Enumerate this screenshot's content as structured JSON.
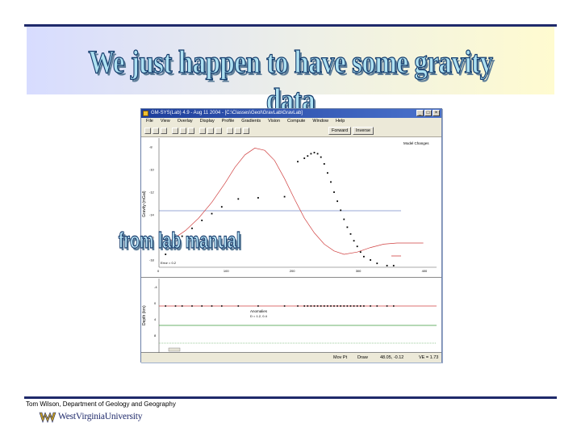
{
  "slide": {
    "title": "We just happen to have some gravity data",
    "callout": "from lab manual",
    "footer_credit": "Tom Wilson, Department of Geology and Geography",
    "institution": "WestVirginiaUniversity"
  },
  "colors": {
    "title_fill": "#aee1f1",
    "title_outline": "#123a6b",
    "rule": "#1f2a6b",
    "titlebar": "#1e3e9a",
    "model_curve": "#d04040",
    "observed_points": "#000000",
    "lower_line_red": "#d04040",
    "lower_line_green": "#3a9a3a"
  },
  "window": {
    "title": "GM-SYS(Lab) 4.9 - Aug 11 2004 - [C:\\Classes\\GeoI\\GravLab\\GravLab]",
    "controls": [
      "_",
      "□",
      "×"
    ],
    "menu": [
      "File",
      "View",
      "Overlay",
      "Display",
      "Profile",
      "Gradients",
      "Vision",
      "Compute",
      "Window",
      "Help"
    ],
    "toolbar_buttons": [
      "Forward",
      "Inverse"
    ],
    "upper_plot": {
      "y_label": "Gravity (mGal)",
      "legend_label": "Model Changes",
      "error_label": "Error = 0.2"
    },
    "lower_plot": {
      "y_label": "Depth (km)",
      "annotation_title": "Anomalies",
      "annotation_value": "D = 1.2, 0.4"
    },
    "status": {
      "mode": "Mov Pt",
      "action": "Draw",
      "coords": "48.05, -0.12",
      "ve": "VE = 1.73"
    }
  },
  "chart_data": {
    "type": "scatter",
    "x_ticks": [
      "0",
      "100",
      "200",
      "300",
      "400"
    ],
    "y_ticks": [
      "-8",
      "-10",
      "-12",
      "-14",
      "-16",
      "-18"
    ],
    "xlim": [
      0,
      420
    ],
    "ylim": [
      -18.5,
      -7.5
    ],
    "observed": {
      "x": [
        10,
        25,
        35,
        50,
        65,
        80,
        95,
        120,
        150,
        190,
        210,
        220,
        225,
        230,
        235,
        240,
        245,
        250,
        255,
        260,
        265,
        270,
        275,
        280,
        285,
        290,
        295,
        300,
        305,
        310,
        320,
        330,
        345,
        355
      ],
      "y": [
        -17.5,
        -16.6,
        -15.9,
        -15.2,
        -14.5,
        -13.9,
        -13.3,
        -12.6,
        -12.5,
        -12.4,
        -9.3,
        -9.0,
        -8.8,
        -8.6,
        -8.5,
        -8.6,
        -8.9,
        -9.5,
        -10.3,
        -11.1,
        -12.0,
        -12.8,
        -13.6,
        -14.4,
        -15.1,
        -15.7,
        -16.3,
        -16.8,
        -17.3,
        -17.7,
        -18.0,
        -18.3,
        -18.5,
        -18.5
      ]
    },
    "model": {
      "x": [
        0,
        20,
        40,
        60,
        80,
        100,
        115,
        130,
        145,
        160,
        175,
        190,
        205,
        220,
        235,
        250,
        265,
        280,
        300,
        320,
        340,
        360,
        380,
        400
      ],
      "y": [
        -16.8,
        -16.2,
        -15.4,
        -14.3,
        -12.9,
        -11.2,
        -9.8,
        -8.7,
        -8.1,
        -8.3,
        -9.2,
        -10.8,
        -12.6,
        -14.3,
        -15.6,
        -16.6,
        -17.2,
        -17.5,
        -17.3,
        -16.9,
        -16.6,
        -16.5,
        -16.5,
        -16.5
      ]
    }
  }
}
